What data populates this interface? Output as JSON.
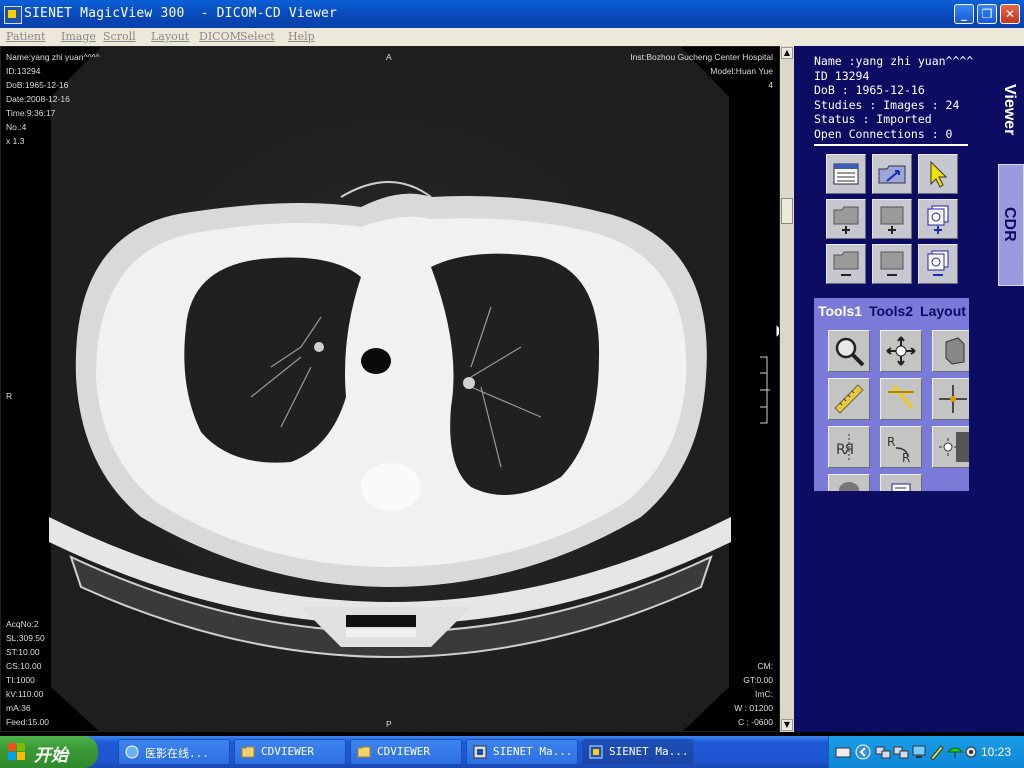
{
  "window": {
    "title": "SIENET MagicView 300  - DICOM-CD Viewer",
    "minimize_label": "_",
    "restore_label": "❐",
    "close_label": "✕"
  },
  "menu": [
    "Patient",
    "Image",
    "Scroll",
    "Layout",
    "DICOM",
    "Select",
    "Help"
  ],
  "viewer": {
    "top_left": [
      "Name:yang zhi yuan^^^^",
      "ID:13294",
      "DoB:1965-12-16",
      "Date:2008-12-16",
      "Time:9:36:17",
      "No.:4",
      "x 1.3"
    ],
    "top_center": "A",
    "top_right": [
      "Inst:Bozhou Gucheng Center Hospital",
      "Model:Huan Yue",
      "4"
    ],
    "left_center": "R",
    "bottom_center": "P",
    "bottom_left": [
      "AcqNo:2",
      "SL:309.50",
      "ST:10.00",
      "CS:10.00",
      "TI:1000",
      "kV:110.00",
      "mA:36",
      "Feed:15.00"
    ],
    "bottom_right": [
      "CM:",
      "GT:0.00",
      "ImC:",
      "W : 01200",
      "C : -0600"
    ]
  },
  "info": {
    "lines": [
      "Name :yang zhi yuan^^^^",
      "ID 13294",
      "DoB : 1965-12-16",
      "Studies : Images : 24",
      "Status : Imported",
      "Open Connections : 0"
    ]
  },
  "side_tabs": {
    "viewer": "Viewer",
    "cdr": "CDR"
  },
  "tools": {
    "tabs": [
      "Tools1",
      "Tools2",
      "Layout"
    ],
    "active_tab": "Tools1"
  },
  "icons": {
    "grid": [
      "patient-list-icon",
      "open-folder-icon",
      "pointer-arrow-icon",
      "add-folder-icon",
      "add-series-icon",
      "add-image-icon",
      "remove-folder-icon",
      "remove-series-icon",
      "remove-image-icon"
    ],
    "tools": [
      "magnifier-icon",
      "pan-icon",
      "rotate-3d-icon",
      "ruler-icon",
      "angle-icon",
      "crosshair-icon",
      "flip-icon",
      "rotate-icon",
      "brightness-icon",
      "roi-icon",
      "annotation-icon"
    ]
  },
  "taskbar": {
    "start_label": "开始",
    "tasks": [
      "医影在线...",
      "CDVIEWER",
      "CDVIEWER",
      "SIENET Ma...",
      "SIENET Ma..."
    ],
    "clock": "10:23"
  },
  "colors": {
    "titlebar": "#0a5fd6",
    "side_panel": "#0c0c63",
    "tools_panel": "#7a7ad8",
    "taskbar": "#1f55cf",
    "start": "#3a9a35"
  }
}
